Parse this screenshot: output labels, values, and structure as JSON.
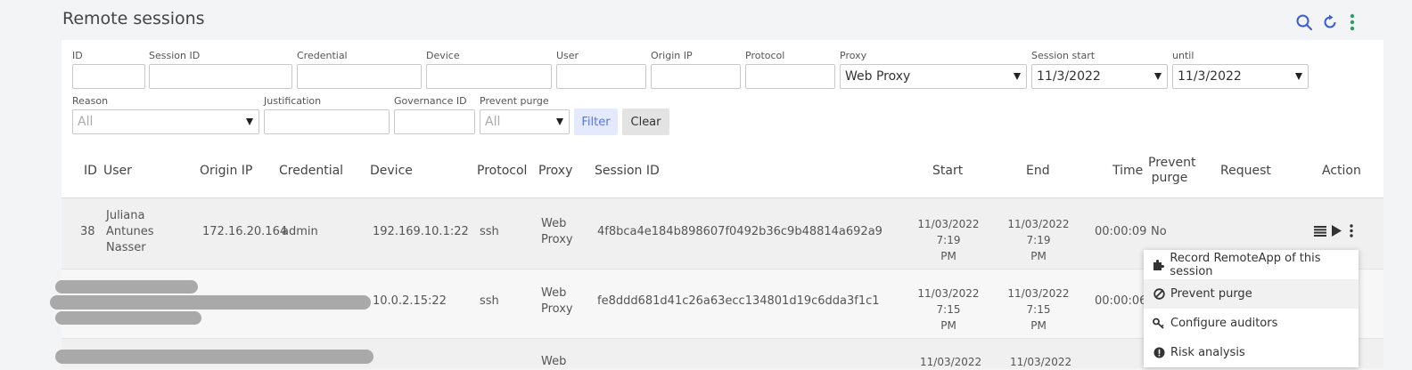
{
  "header": {
    "title": "Remote sessions",
    "icons": [
      "search-icon",
      "refresh-icon",
      "kebab-menu-icon"
    ],
    "accent_colors": {
      "search": "#3b5bdb",
      "refresh": "#3b5bdb",
      "kebab": "#2e9e5e"
    }
  },
  "filters": {
    "id": {
      "label": "ID",
      "value": ""
    },
    "session_id": {
      "label": "Session ID",
      "value": ""
    },
    "credential": {
      "label": "Credential",
      "value": ""
    },
    "device": {
      "label": "Device",
      "value": ""
    },
    "user": {
      "label": "User",
      "value": ""
    },
    "origin_ip": {
      "label": "Origin IP",
      "value": ""
    },
    "protocol": {
      "label": "Protocol",
      "value": ""
    },
    "proxy": {
      "label": "Proxy",
      "value": "Web Proxy"
    },
    "session_start": {
      "label": "Session start",
      "value": "11/3/2022"
    },
    "until": {
      "label": "until",
      "value": "11/3/2022"
    },
    "reason": {
      "label": "Reason",
      "value": "All"
    },
    "justification": {
      "label": "Justification",
      "value": ""
    },
    "governance_id": {
      "label": "Governance ID",
      "value": ""
    },
    "prevent_purge": {
      "label": "Prevent purge",
      "value": "All"
    },
    "filter_button": "Filter",
    "clear_button": "Clear"
  },
  "table": {
    "columns": {
      "id": "ID",
      "user": "User",
      "origin_ip": "Origin IP",
      "credential": "Credential",
      "device": "Device",
      "protocol": "Protocol",
      "proxy": "Proxy",
      "session_id": "Session ID",
      "start": "Start",
      "end": "End",
      "time": "Time",
      "prevent_purge_1": "Prevent",
      "prevent_purge_2": "purge",
      "request": "Request",
      "action": "Action"
    },
    "rows": [
      {
        "id": "38",
        "user_lines": [
          "Juliana",
          "Antunes",
          "Nasser"
        ],
        "origin_ip": "172.16.20.164",
        "credential": "admin",
        "device": "192.169.10.1:22",
        "protocol": "ssh",
        "proxy_lines": [
          "Web",
          "Proxy"
        ],
        "session_id": "4f8bca4e184b898607f0492b36c9b48814a692a9",
        "start_lines": [
          "11/03/2022 7:19",
          "PM"
        ],
        "end_lines": [
          "11/03/2022 7:19",
          "PM"
        ],
        "time": "00:00:09",
        "prevent_purge": "No",
        "request": ""
      },
      {
        "id": "",
        "user_lines": [],
        "origin_ip": "",
        "credential": "",
        "device": "10.0.2.15:22",
        "protocol": "ssh",
        "proxy_lines": [
          "Web",
          "Proxy"
        ],
        "session_id": "fe8ddd681d41c26a63ecc134801d19c6dda3f1c1",
        "start_lines": [
          "11/03/2022 7:15",
          "PM"
        ],
        "end_lines": [
          "11/03/2022 7:15",
          "PM"
        ],
        "time": "00:00:06",
        "prevent_purge": "",
        "request": ""
      },
      {
        "proxy_line": "Web",
        "start_line": "11/03/2022",
        "end_line": "11/03/2022"
      }
    ]
  },
  "action_menu": {
    "items": [
      {
        "label": "Record RemoteApp of this session",
        "icon": "puzzle-icon"
      },
      {
        "label": "Prevent purge",
        "icon": "block-icon",
        "highlighted": true
      },
      {
        "label": "Configure auditors",
        "icon": "key-icon"
      },
      {
        "label": "Risk analysis",
        "icon": "alert-circle-icon"
      }
    ]
  }
}
